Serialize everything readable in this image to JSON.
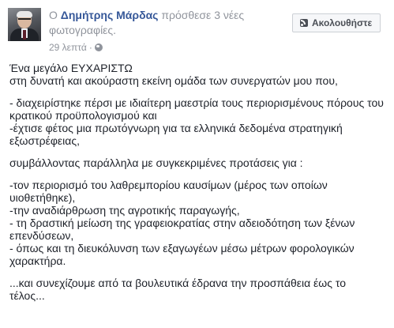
{
  "post": {
    "author": "Δημήτρης Μάρδας",
    "prefix": "Ο ",
    "action": " πρόσθεσε 3 νέες φωτογραφίες.",
    "timestamp": "29 λεπτά",
    "separator": "·",
    "follow_label": "Ακολουθήστε",
    "body": {
      "p1_line1": "Ένα μεγάλο ΕΥΧΑΡΙΣΤΩ",
      "p1_line2": "στη δυνατή και ακούραστη εκείνη ομάδα των συνεργατών μου που,",
      "p2_line1": "- διαχειρίστηκε πέρσι με ιδιαίτερη μαεστρία τους περιορισμένους πόρους του",
      "p2_line2": "κρατικού προϋπολογισμού και",
      "p2_line3": "-έχτισε φέτος μια πρωτόγνωρη για τα ελληνικά δεδομένα στρατηγική",
      "p2_line4": "εξωστρέφειας,",
      "p3_line1": "συμβάλλοντας παράλληλα με συγκεκριμένες προτάσεις για :",
      "p4_line1": "-τον περιορισμό του λαθρεμπορίου καυσίμων (μέρος των οποίων",
      "p4_line2": "υιοθετήθηκε),",
      "p4_line3": "-την αναδιάρθρωση της αγροτικής παραγωγής,",
      "p4_line4": "- τη δραστική μείωση της γραφειοκρατίας στην αδειοδότηση των ξένων",
      "p4_line5": "επενδύσεων,",
      "p4_line6": "- όπως και τη διευκόλυνση των εξαγωγέων μέσω μέτρων φορολογικών",
      "p4_line7": "χαρακτήρα.",
      "p5_line1": "...και συνεχίζουμε από τα βουλευτικά έδρανα την προσπάθεια έως το",
      "p5_line2": "τέλος..."
    }
  },
  "colors": {
    "name_link": "#365899",
    "meta_gray": "#90949c",
    "body_text": "#1d2129",
    "button_bg": "#f6f7f9",
    "button_border": "#ccd0d5"
  },
  "icons": {
    "privacy": "globe-icon",
    "follow": "rss-icon"
  }
}
